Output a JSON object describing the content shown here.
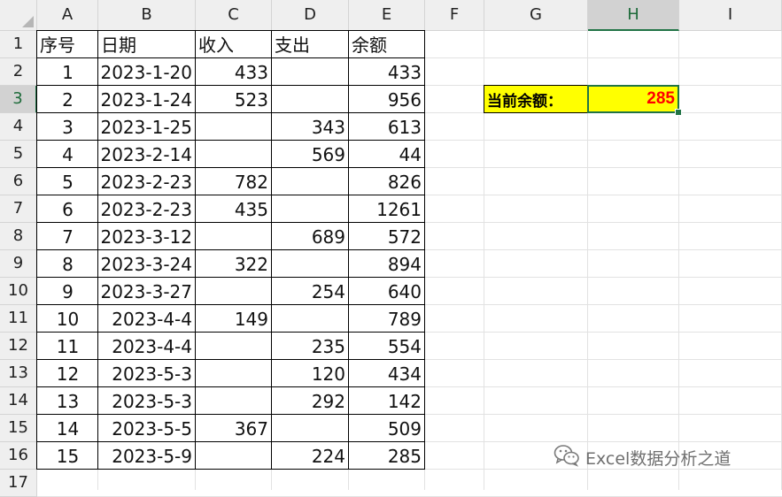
{
  "columns": [
    "A",
    "B",
    "C",
    "D",
    "E",
    "F",
    "G",
    "H",
    "I"
  ],
  "rows": [
    "1",
    "2",
    "3",
    "4",
    "5",
    "6",
    "7",
    "8",
    "9",
    "10",
    "11",
    "12",
    "13",
    "14",
    "15",
    "16",
    "17"
  ],
  "selected_column": "H",
  "selected_row": "3",
  "table": {
    "headers": [
      "序号",
      "日期",
      "收入",
      "支出",
      "余额"
    ],
    "rows": [
      [
        "1",
        "2023-1-20",
        "433",
        "",
        "433"
      ],
      [
        "2",
        "2023-1-24",
        "523",
        "",
        "956"
      ],
      [
        "3",
        "2023-1-25",
        "",
        "343",
        "613"
      ],
      [
        "4",
        "2023-2-14",
        "",
        "569",
        "44"
      ],
      [
        "5",
        "2023-2-23",
        "782",
        "",
        "826"
      ],
      [
        "6",
        "2023-2-23",
        "435",
        "",
        "1261"
      ],
      [
        "7",
        "2023-3-12",
        "",
        "689",
        "572"
      ],
      [
        "8",
        "2023-3-24",
        "322",
        "",
        "894"
      ],
      [
        "9",
        "2023-3-27",
        "",
        "254",
        "640"
      ],
      [
        "10",
        "2023-4-4",
        "149",
        "",
        "789"
      ],
      [
        "11",
        "2023-4-4",
        "",
        "235",
        "554"
      ],
      [
        "12",
        "2023-5-3",
        "",
        "120",
        "434"
      ],
      [
        "13",
        "2023-5-3",
        "",
        "292",
        "142"
      ],
      [
        "14",
        "2023-5-5",
        "367",
        "",
        "509"
      ],
      [
        "15",
        "2023-5-9",
        "",
        "224",
        "285"
      ]
    ]
  },
  "summary": {
    "label": "当前余额：",
    "value": "285"
  },
  "watermark": {
    "text": "Excel数据分析之道",
    "icon": "wechat-icon"
  },
  "colors": {
    "highlight_fill": "#ffff00",
    "value_text": "#ff0000",
    "selection_border": "#217346"
  }
}
